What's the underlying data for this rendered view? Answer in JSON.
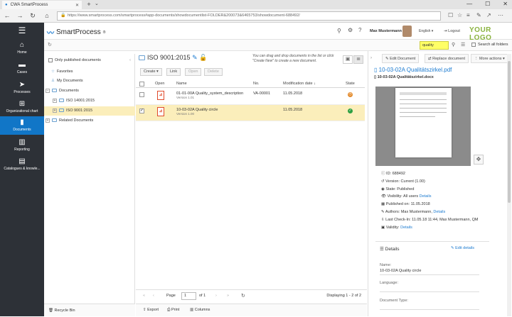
{
  "browser": {
    "tab_title": "CWA SmartProcess",
    "url": "https://www.smartprocess.com/smartprocess#app-documents/showdocumentlist-FOLDER&200073&6465753/showdocument-688492/"
  },
  "nav": [
    {
      "label": "Home",
      "icon": "home-icon"
    },
    {
      "label": "Cases",
      "icon": "folder-icon"
    },
    {
      "label": "Processes",
      "icon": "process-icon"
    },
    {
      "label": "Organizational chart",
      "icon": "org-chart-icon"
    },
    {
      "label": "Documents",
      "icon": "document-icon"
    },
    {
      "label": "Reporting",
      "icon": "bar-chart-icon"
    },
    {
      "label": "Catalogues & knowle...",
      "icon": "book-icon"
    }
  ],
  "header": {
    "brand": "SmartProcess",
    "user": "Max Mustermann",
    "language": "English",
    "logout": "Logout",
    "your_logo": "YOUR LOGO"
  },
  "search": {
    "value": "quality",
    "all_folders": "Search all folders"
  },
  "tree": {
    "only_published": "Only published documents",
    "items": [
      {
        "label": "Favorites"
      },
      {
        "label": "My Documents"
      },
      {
        "label": "Documents"
      },
      {
        "label": "ISO 14001:2015"
      },
      {
        "label": "ISO 9001:2015"
      },
      {
        "label": "Related Documents"
      }
    ],
    "recycle_bin": "Recycle Bin"
  },
  "center": {
    "breadcrumb": "ISO 9001:2015",
    "hint": "You can drag and drop documents in the list or click \"Create New\" to create a new document.",
    "toolbar": {
      "create": "Create",
      "link": "Link",
      "open": "Open",
      "delete": "Delete"
    },
    "columns": [
      "Open",
      "Name",
      "No.",
      "Modification date",
      "State"
    ],
    "rows": [
      {
        "name": "01-01-00A Quality_system_description",
        "version": "Version 1.01",
        "no": "VA-00001",
        "date": "11.05.2018",
        "state": "orange",
        "checked": false
      },
      {
        "name": "10-03-02A Quality circle",
        "version": "Version 1.00",
        "no": "",
        "date": "11.05.2018",
        "state": "green",
        "checked": true
      }
    ],
    "pager": {
      "page_label": "Page",
      "page": "1",
      "of": "of 1",
      "displaying": "Displaying 1 - 2 of 2"
    },
    "footer": {
      "export": "Export",
      "print": "Print",
      "columns": "Columns"
    }
  },
  "right": {
    "edit_document": "Edit Document",
    "replace_document": "Replace document",
    "more_actions": "More actions",
    "doc_title": "10-03-02A Qualitätszirkel.pdf",
    "doc_file": "10-03-02A Qualitätszirkel.docx",
    "props": {
      "id": "ID: 688492",
      "version": "Version: Current (1.00)",
      "state": "State: Published",
      "visibility": "Visibility: All users",
      "visibility_link": "Details",
      "published": "Published on: 11.05.2018",
      "authors": "Authors: Max Mustermann,",
      "authors_link": "Details",
      "last_checkin": "Last Check-In: 11.05.18 11:44, Max Mustermann, QM",
      "validity": "Validity:",
      "validity_link": "Details"
    },
    "details": {
      "title": "Details",
      "edit": "Edit details",
      "name_label": "Name:",
      "name_value": "10-03-02A Quality circle",
      "language_label": "Language:",
      "doctype_label": "Document Type:"
    }
  },
  "colors": {
    "nav_bg": "#2d3137",
    "accent": "#1176c7",
    "selected_row": "#fbeebb",
    "logo_green": "#8ab33f"
  }
}
